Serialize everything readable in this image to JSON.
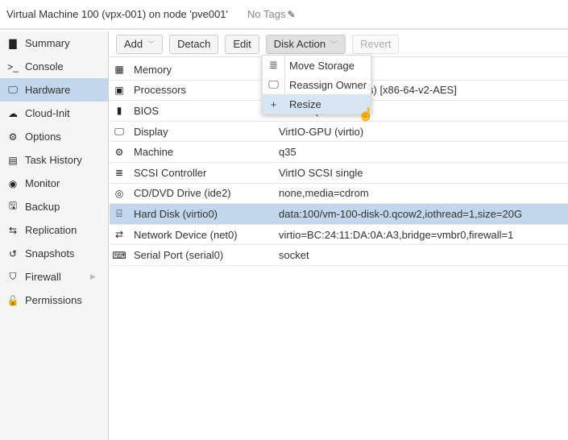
{
  "header": {
    "title": "Virtual Machine 100 (vpx-001) on node 'pve001'",
    "tags": "No Tags",
    "edit_icon": "pencil-icon"
  },
  "sidebar": {
    "items": [
      {
        "label": "Summary",
        "icon": "book-icon",
        "glyph": "▇"
      },
      {
        "label": "Console",
        "icon": "terminal-icon",
        "glyph": ">_"
      },
      {
        "label": "Hardware",
        "icon": "monitor-icon",
        "glyph": "🖵",
        "active": true
      },
      {
        "label": "Cloud-Init",
        "icon": "cloud-icon",
        "glyph": "☁"
      },
      {
        "label": "Options",
        "icon": "gear-icon",
        "glyph": "⚙"
      },
      {
        "label": "Task History",
        "icon": "list-icon",
        "glyph": "▤"
      },
      {
        "label": "Monitor",
        "icon": "eye-icon",
        "glyph": "◉"
      },
      {
        "label": "Backup",
        "icon": "floppy-icon",
        "glyph": "🖫"
      },
      {
        "label": "Replication",
        "icon": "retweet-icon",
        "glyph": "⇆"
      },
      {
        "label": "Snapshots",
        "icon": "history-icon",
        "glyph": "↺"
      },
      {
        "label": "Firewall",
        "icon": "shield-icon",
        "glyph": "⛉"
      },
      {
        "label": "Permissions",
        "icon": "unlock-icon",
        "glyph": "🔓"
      }
    ]
  },
  "toolbar": {
    "add": "Add",
    "detach": "Detach",
    "edit": "Edit",
    "disk_action": "Disk Action",
    "revert": "Revert"
  },
  "grid": {
    "rows": [
      {
        "name": "Memory",
        "value": "",
        "icon": "memory-icon",
        "glyph": "▦"
      },
      {
        "name": "Processors",
        "value": "s) [x86-64-v2-AES]",
        "icon": "cpu-icon",
        "glyph": "▣"
      },
      {
        "name": "BIOS",
        "value": "Default (SeaBIOS)",
        "icon": "bios-icon",
        "glyph": "▮"
      },
      {
        "name": "Display",
        "value": "VirtIO-GPU (virtio)",
        "icon": "desktop-icon",
        "glyph": "🖵"
      },
      {
        "name": "Machine",
        "value": "q35",
        "icon": "cogs-icon",
        "glyph": "⚙"
      },
      {
        "name": "SCSI Controller",
        "value": "VirtIO SCSI single",
        "icon": "database-icon",
        "glyph": "≣"
      },
      {
        "name": "CD/DVD Drive (ide2)",
        "value": "none,media=cdrom",
        "icon": "cdrom-icon",
        "glyph": "◎"
      },
      {
        "name": "Hard Disk (virtio0)",
        "value": "data:100/vm-100-disk-0.qcow2,iothread=1,size=20G",
        "icon": "hdd-icon",
        "glyph": "⌸",
        "selected": true
      },
      {
        "name": "Network Device (net0)",
        "value": "virtio=BC:24:11:DA:0A:A3,bridge=vmbr0,firewall=1",
        "icon": "exchange-icon",
        "glyph": "⇄"
      },
      {
        "name": "Serial Port (serial0)",
        "value": "socket",
        "icon": "keyboard-icon",
        "glyph": "⌨"
      }
    ]
  },
  "disk_menu": {
    "items": [
      {
        "label": "Move Storage",
        "icon": "database-icon",
        "glyph": "≣"
      },
      {
        "label": "Reassign Owner",
        "icon": "desktop-icon",
        "glyph": "🖵"
      },
      {
        "label": "Resize",
        "icon": "plus-icon",
        "glyph": "+",
        "highlighted": true
      }
    ]
  }
}
